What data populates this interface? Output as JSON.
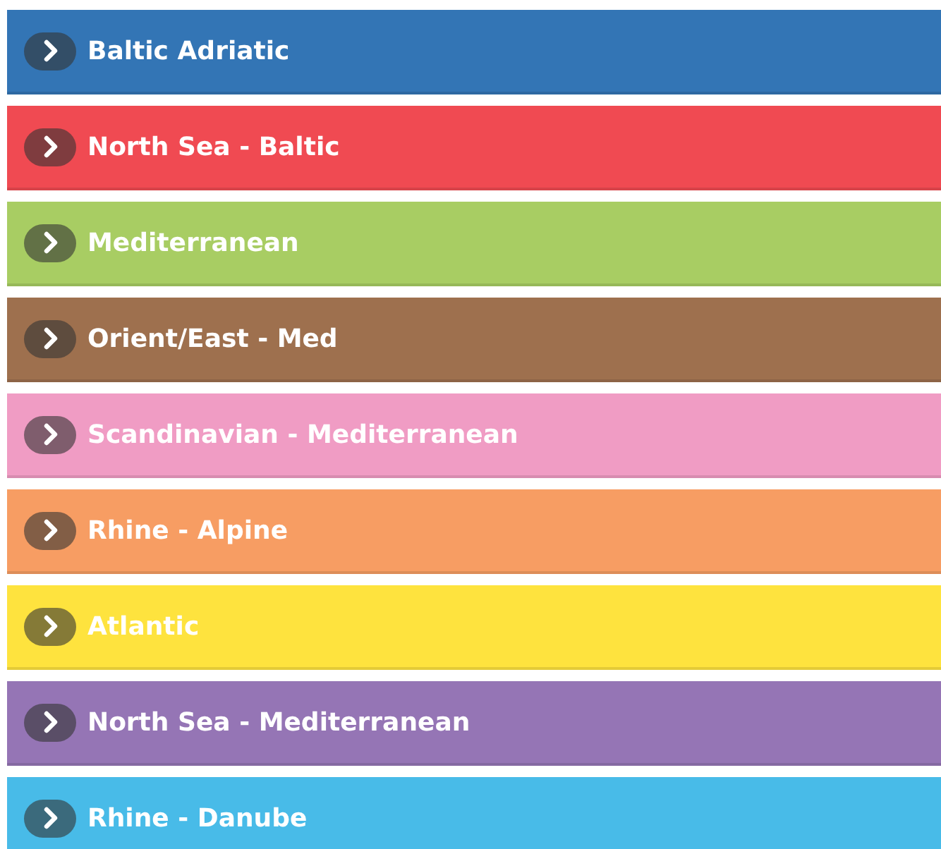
{
  "routes": [
    {
      "label": "Baltic Adriatic",
      "color": "#3375b5"
    },
    {
      "label": "North Sea - Baltic",
      "color": "#f04a52"
    },
    {
      "label": "Mediterranean",
      "color": "#a8cd63"
    },
    {
      "label": "Orient/East - Med",
      "color": "#9e704e"
    },
    {
      "label": "Scandinavian - Mediterranean",
      "color": "#f09cc4"
    },
    {
      "label": "Rhine - Alpine",
      "color": "#f79d63"
    },
    {
      "label": "Atlantic",
      "color": "#fee33e"
    },
    {
      "label": "North Sea - Mediterranean",
      "color": "#9575b5"
    },
    {
      "label": "Rhine - Danube",
      "color": "#48bbe8"
    }
  ]
}
